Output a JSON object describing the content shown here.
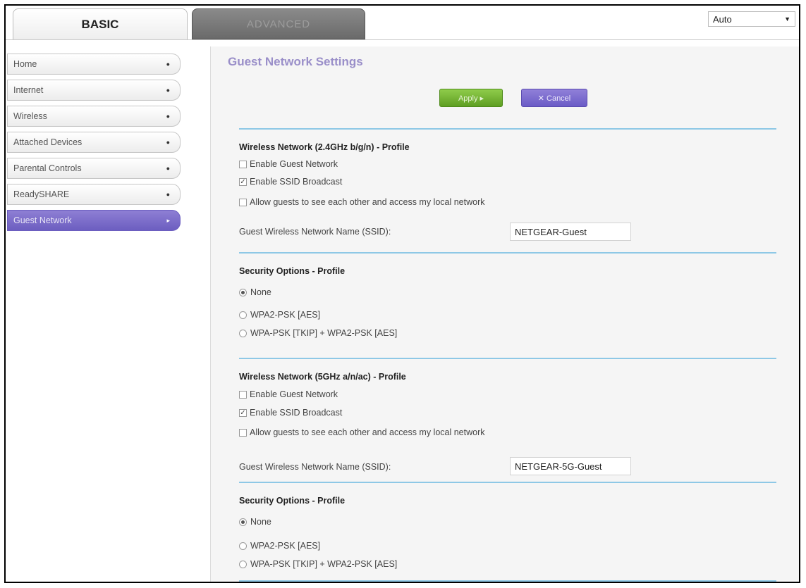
{
  "tabs": {
    "basic": "BASIC",
    "advanced": "ADVANCED"
  },
  "language": {
    "selected": "Auto"
  },
  "sidebar": {
    "items": [
      {
        "label": "Home"
      },
      {
        "label": "Internet"
      },
      {
        "label": "Wireless"
      },
      {
        "label": "Attached Devices"
      },
      {
        "label": "Parental Controls"
      },
      {
        "label": "ReadySHARE"
      },
      {
        "label": "Guest Network"
      }
    ]
  },
  "main": {
    "title": "Guest Network Settings",
    "apply_label": "Apply ▸",
    "cancel_label": "✕ Cancel",
    "band24": {
      "heading": "Wireless Network (2.4GHz b/g/n) - Profile",
      "enable_guest": "Enable Guest Network",
      "enable_guest_checked": false,
      "enable_ssid": "Enable SSID Broadcast",
      "enable_ssid_checked": true,
      "allow_guests": "Allow guests to see each other and access my local network",
      "allow_guests_checked": false,
      "ssid_label": "Guest Wireless Network Name (SSID):",
      "ssid_value": "NETGEAR-Guest",
      "security_heading": "Security Options - Profile",
      "security_options": [
        "None",
        "WPA2-PSK [AES]",
        "WPA-PSK [TKIP] + WPA2-PSK [AES]"
      ],
      "security_selected": "None"
    },
    "band5": {
      "heading": "Wireless Network (5GHz a/n/ac) - Profile",
      "enable_guest": "Enable Guest Network",
      "enable_guest_checked": false,
      "enable_ssid": "Enable SSID Broadcast",
      "enable_ssid_checked": true,
      "allow_guests": "Allow guests to see each other and access my local network",
      "allow_guests_checked": false,
      "ssid_label": "Guest Wireless Network Name (SSID):",
      "ssid_value": "NETGEAR-5G-Guest",
      "security_heading": "Security Options - Profile",
      "security_options": [
        "None",
        "WPA2-PSK [AES]",
        "WPA-PSK [TKIP] + WPA2-PSK [AES]"
      ],
      "security_selected": "None"
    }
  }
}
